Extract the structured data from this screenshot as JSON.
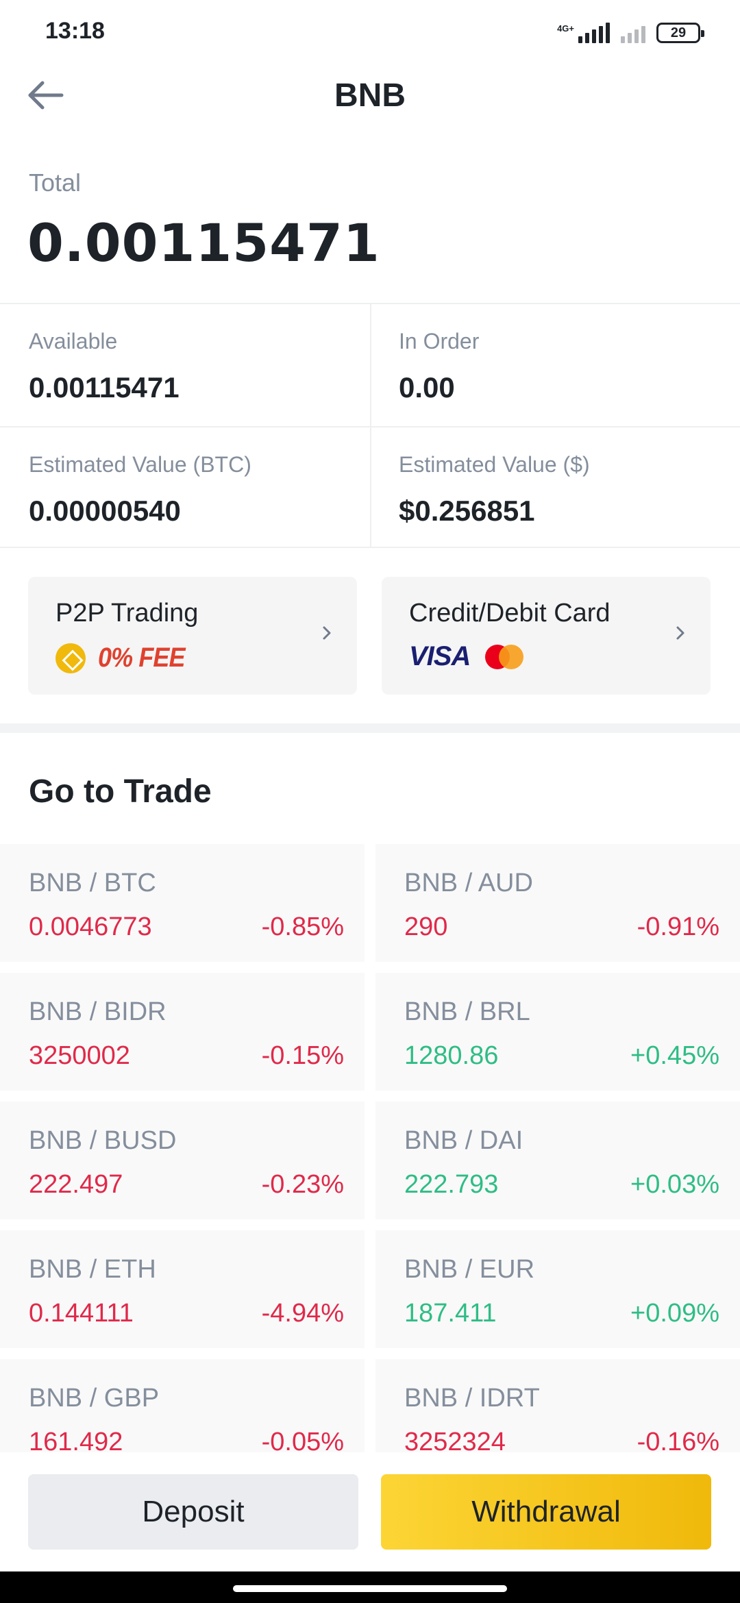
{
  "status_bar": {
    "time": "13:18",
    "network": "4G+",
    "battery": "29"
  },
  "header": {
    "title": "BNB",
    "back_icon": "arrow-left-icon"
  },
  "total": {
    "label": "Total",
    "value": "0.00115471"
  },
  "details": {
    "available_label": "Available",
    "available_value": "0.00115471",
    "in_order_label": "In Order",
    "in_order_value": "0.00",
    "est_btc_label": "Estimated Value (BTC)",
    "est_btc_value": "0.00000540",
    "est_usd_label": "Estimated Value ($)",
    "est_usd_value": "$0.256851"
  },
  "promos": {
    "p2p_title": "P2P Trading",
    "p2p_fee": "0% FEE",
    "card_title": "Credit/Debit Card",
    "visa": "VISA"
  },
  "trade": {
    "heading": "Go to Trade",
    "pairs": [
      {
        "name": "BNB / BTC",
        "price": "0.0046773",
        "change": "-0.85%",
        "direction": "down"
      },
      {
        "name": "BNB / AUD",
        "price": "290",
        "change": "-0.91%",
        "direction": "down"
      },
      {
        "name": "BNB / BIDR",
        "price": "3250002",
        "change": "-0.15%",
        "direction": "down"
      },
      {
        "name": "BNB / BRL",
        "price": "1280.86",
        "change": "+0.45%",
        "direction": "up"
      },
      {
        "name": "BNB / BUSD",
        "price": "222.497",
        "change": "-0.23%",
        "direction": "down"
      },
      {
        "name": "BNB / DAI",
        "price": "222.793",
        "change": "+0.03%",
        "direction": "up"
      },
      {
        "name": "BNB / ETH",
        "price": "0.144111",
        "change": "-4.94%",
        "direction": "down"
      },
      {
        "name": "BNB / EUR",
        "price": "187.411",
        "change": "+0.09%",
        "direction": "up"
      },
      {
        "name": "BNB / GBP",
        "price": "161.492",
        "change": "-0.05%",
        "direction": "down"
      },
      {
        "name": "BNB / IDRT",
        "price": "3252324",
        "change": "-0.16%",
        "direction": "down"
      }
    ]
  },
  "actions": {
    "deposit": "Deposit",
    "withdrawal": "Withdrawal"
  },
  "colors": {
    "negative": "#e0294a",
    "positive": "#2ebd85",
    "accent": "#f0b90b"
  }
}
